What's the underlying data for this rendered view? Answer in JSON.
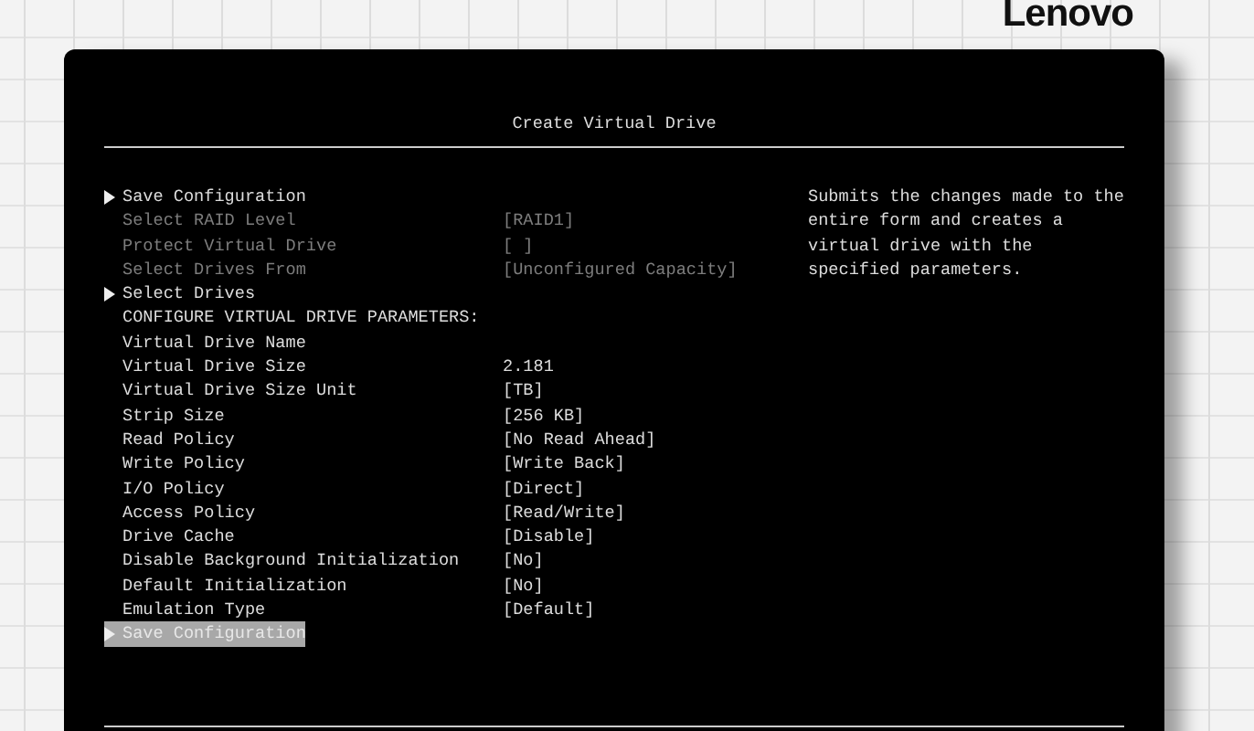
{
  "logo": "Lenovo",
  "screen": {
    "title": "Create Virtual Drive",
    "items": [
      {
        "kind": "submenu",
        "label": "Save Configuration",
        "disabled": false,
        "selected": false
      },
      {
        "kind": "setting",
        "label": "Select RAID Level",
        "value": "[RAID1]",
        "disabled": true,
        "selected": false
      },
      {
        "kind": "setting",
        "label": "Protect Virtual Drive",
        "value": "[ ]",
        "disabled": true,
        "selected": false
      },
      {
        "kind": "setting",
        "label": "Select Drives From",
        "value": "[Unconfigured Capacity]",
        "disabled": true,
        "selected": false
      },
      {
        "kind": "submenu",
        "label": "Select Drives",
        "disabled": false,
        "selected": false
      },
      {
        "kind": "heading",
        "label": "CONFIGURE VIRTUAL DRIVE PARAMETERS:",
        "disabled": false,
        "selected": false
      },
      {
        "kind": "setting",
        "label": "Virtual Drive Name",
        "disabled": false,
        "selected": false
      },
      {
        "kind": "setting",
        "label": "Virtual Drive Size",
        "value": "2.181",
        "disabled": false,
        "selected": false
      },
      {
        "kind": "setting",
        "label": "Virtual Drive Size Unit",
        "value": "[TB]",
        "disabled": false,
        "selected": false
      },
      {
        "kind": "setting",
        "label": "Strip Size",
        "value": "[256 KB]",
        "disabled": false,
        "selected": false
      },
      {
        "kind": "setting",
        "label": "Read Policy",
        "value": "[No Read Ahead]",
        "disabled": false,
        "selected": false
      },
      {
        "kind": "setting",
        "label": "Write Policy",
        "value": "[Write Back]",
        "disabled": false,
        "selected": false
      },
      {
        "kind": "setting",
        "label": "I/O Policy",
        "value": "[Direct]",
        "disabled": false,
        "selected": false
      },
      {
        "kind": "setting",
        "label": "Access Policy",
        "value": "[Read/Write]",
        "disabled": false,
        "selected": false
      },
      {
        "kind": "setting",
        "label": "Drive Cache",
        "value": "[Disable]",
        "disabled": false,
        "selected": false
      },
      {
        "kind": "setting",
        "label": "Disable Background Initialization",
        "value": "[No]",
        "disabled": false,
        "selected": false
      },
      {
        "kind": "setting",
        "label": "Default Initialization",
        "value": "[No]",
        "disabled": false,
        "selected": false
      },
      {
        "kind": "setting",
        "label": "Emulation Type",
        "value": "[Default]",
        "disabled": false,
        "selected": false
      },
      {
        "kind": "submenu",
        "label": "Save Configuration",
        "disabled": false,
        "selected": true
      }
    ],
    "help": "Submits the changes made to the entire form and creates a virtual drive with the specified parameters."
  }
}
